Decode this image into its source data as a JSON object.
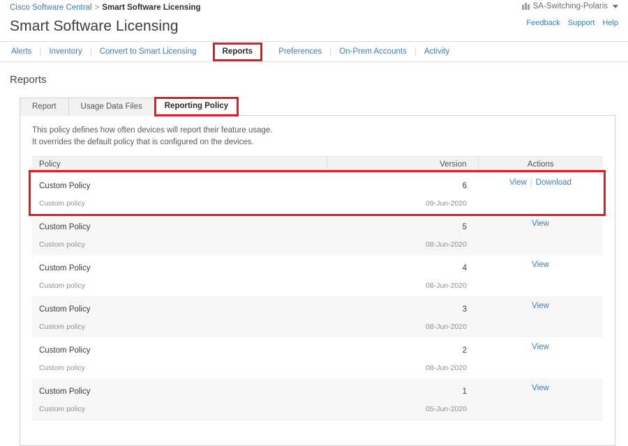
{
  "breadcrumb": {
    "root": "Cisco Software Central",
    "separator": ">",
    "current": "Smart Software Licensing"
  },
  "org_selector": {
    "label": "SA-Switching-Polaris",
    "icon": "organization-icon",
    "caret": "chevron-down-icon"
  },
  "page_title": "Smart Software Licensing",
  "util_links": [
    {
      "label": "Feedback"
    },
    {
      "label": "Support"
    },
    {
      "label": "Help"
    }
  ],
  "nav": {
    "items": [
      {
        "label": "Alerts",
        "active": false
      },
      {
        "label": "Inventory",
        "active": false
      },
      {
        "label": "Convert to Smart Licensing",
        "active": false
      },
      {
        "label": "Reports",
        "active": true,
        "highlighted": true
      },
      {
        "label": "Preferences",
        "active": false
      },
      {
        "label": "On-Prem Accounts",
        "active": false
      },
      {
        "label": "Activity",
        "active": false
      }
    ]
  },
  "section": {
    "title": "Reports"
  },
  "subtabs": [
    {
      "label": "Report",
      "active": false,
      "highlighted": false
    },
    {
      "label": "Usage Data Files",
      "active": false,
      "highlighted": false
    },
    {
      "label": "Reporting Policy",
      "active": true,
      "highlighted": true
    }
  ],
  "panel": {
    "description_line1": "This policy defines how often devices will report their feature usage.",
    "description_line2": "It overrides the default policy that is configured on the devices."
  },
  "table": {
    "columns": {
      "policy": "Policy",
      "version": "Version",
      "actions": "Actions"
    },
    "rows": [
      {
        "policy": "Custom Policy",
        "description": "Custom policy",
        "version": "6",
        "date": "09-Jun-2020",
        "actions": [
          "View",
          "Download"
        ],
        "striped": false,
        "highlighted": true
      },
      {
        "policy": "Custom Policy",
        "description": "Custom policy",
        "version": "5",
        "date": "08-Jun-2020",
        "actions": [
          "View"
        ],
        "striped": true,
        "highlighted": false
      },
      {
        "policy": "Custom Policy",
        "description": "Custom policy",
        "version": "4",
        "date": "08-Jun-2020",
        "actions": [
          "View"
        ],
        "striped": false,
        "highlighted": false
      },
      {
        "policy": "Custom Policy",
        "description": "Custom policy",
        "version": "3",
        "date": "08-Jun-2020",
        "actions": [
          "View"
        ],
        "striped": true,
        "highlighted": false
      },
      {
        "policy": "Custom Policy",
        "description": "Custom policy",
        "version": "2",
        "date": "08-Jun-2020",
        "actions": [
          "View"
        ],
        "striped": false,
        "highlighted": false
      },
      {
        "policy": "Custom Policy",
        "description": "Custom policy",
        "version": "1",
        "date": "05-Jun-2020",
        "actions": [
          "View"
        ],
        "striped": true,
        "highlighted": false
      }
    ]
  },
  "colors": {
    "link": "#3b7ebf",
    "annotation": "#e01b21",
    "header_bg": "#f2f2f2",
    "stripe_bg": "#f6f6f6"
  }
}
